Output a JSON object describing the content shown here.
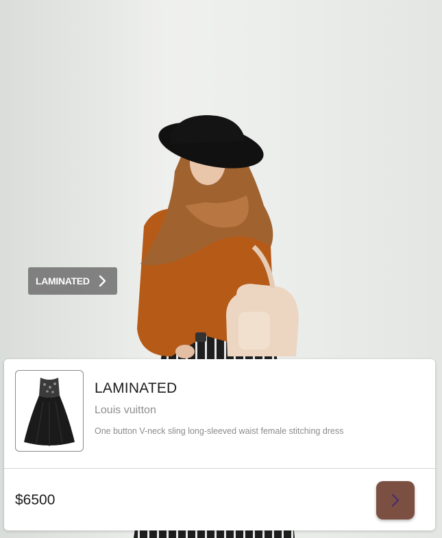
{
  "hero": {
    "image": "woman-in-hat-and-hijab-photo"
  },
  "tag_chip": {
    "label": "LAMINATED",
    "icon": "chevron-right-icon"
  },
  "product": {
    "thumbnail": "black-dress-thumbnail",
    "title": "LAMINATED",
    "brand": "Louis vuitton",
    "description": "One button V-neck sling long-sleeved waist female stitching dress",
    "price": "$6500",
    "action_icon": "chevron-right-icon"
  },
  "colors": {
    "accent_button": "#7b5043",
    "chevron": "#4a2c6e",
    "chip_bg": "#6e6e6e"
  }
}
